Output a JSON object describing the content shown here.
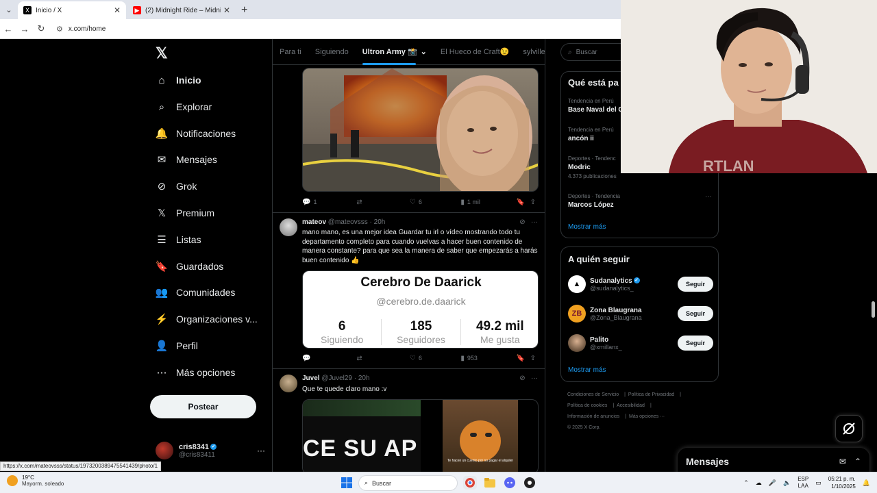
{
  "browser": {
    "tabs": [
      {
        "title": "Inicio / X",
        "active": true
      },
      {
        "title": "(2) Midnight Ride – Midnight R",
        "active": false
      }
    ],
    "url": "x.com/home",
    "status_url": "https://x.com/mateovsss/status/1973200389475541439/photo/1"
  },
  "sidebar": {
    "items": [
      {
        "label": "Inicio",
        "icon": "home-icon"
      },
      {
        "label": "Explorar",
        "icon": "search-icon"
      },
      {
        "label": "Notificaciones",
        "icon": "bell-icon"
      },
      {
        "label": "Mensajes",
        "icon": "mail-icon"
      },
      {
        "label": "Grok",
        "icon": "grok-icon"
      },
      {
        "label": "Premium",
        "icon": "x-icon"
      },
      {
        "label": "Listas",
        "icon": "list-icon"
      },
      {
        "label": "Guardados",
        "icon": "bookmark-icon"
      },
      {
        "label": "Comunidades",
        "icon": "people-icon"
      },
      {
        "label": "Organizaciones v...",
        "icon": "lightning-icon"
      },
      {
        "label": "Perfil",
        "icon": "person-icon"
      },
      {
        "label": "Más opciones",
        "icon": "more-circle-icon"
      }
    ],
    "post_label": "Postear",
    "account": {
      "name": "cris8341",
      "handle": "@cris83411"
    }
  },
  "timeline": {
    "tabs": [
      "Para ti",
      "Siguiendo",
      "Ultron Army 📸",
      "El Hueco de Craft😉",
      "sylville"
    ],
    "first_post_actions": {
      "replies": "1",
      "likes": "6",
      "views": "1 mil"
    },
    "posts": [
      {
        "name": "mateov",
        "meta": "@mateovsss · 20h",
        "text": "mano mano, es una mejor idea Guardar tu irl o vídeo mostrando todo tu departamento completo para cuando vuelvas a hacer buen contenido de manera constante? para que sea la manera de saber que empezarás a harás buen contenido 👍",
        "card": {
          "title": "Cerebro De Daarick",
          "handle": "@cerebro.de.daarick",
          "stats": [
            {
              "value": "6",
              "label": "Siguiendo"
            },
            {
              "value": "185",
              "label": "Seguidores"
            },
            {
              "value": "49.2 mil",
              "label": "Me gusta"
            }
          ]
        },
        "actions": {
          "replies": "",
          "likes": "6",
          "views": "953"
        }
      },
      {
        "name": "Juvel",
        "meta": "@Juvel29 · 20h",
        "text": "Que te quede claro mano :v",
        "media_text": "CE SU AP",
        "caption": "Te hacen un cuento por no pagar el alquiler"
      }
    ]
  },
  "right": {
    "search_placeholder": "Buscar",
    "trends_title": "Qué está pa",
    "trends": [
      {
        "context": "Tendencia en Perú",
        "title": "Base Naval del C",
        "count": ""
      },
      {
        "context": "Tendencia en Perú",
        "title": "ancón ii",
        "count": ""
      },
      {
        "context": "Deportes · Tendenc",
        "title": "Modric",
        "count": "4.373 publicaciones"
      },
      {
        "context": "Deportes · Tendencia",
        "title": "Marcos López",
        "count": ""
      }
    ],
    "show_more": "Mostrar más",
    "who_title": "A quién seguir",
    "who": [
      {
        "name": "Sudanalytics",
        "handle": "@sudanalytics_",
        "button": "Seguir",
        "verified": true
      },
      {
        "name": "Zona Blaugrana",
        "handle": "@Zona_Blaugrana",
        "button": "Seguir",
        "verified": false
      },
      {
        "name": "Palito",
        "handle": "@xmillanx_",
        "button": "Seguir",
        "verified": false
      }
    ],
    "who_more": "Mostrar más",
    "footer": [
      "Condiciones de Servicio",
      "Política de Privacidad",
      "Política de cookies",
      "Accesibilidad",
      "Información de anuncios",
      "Más opciones ···",
      "© 2025 X Corp."
    ],
    "messages_title": "Mensajes"
  },
  "taskbar": {
    "weather_temp": "19°C",
    "weather_desc": "Mayorm. soleado",
    "search_label": "Buscar",
    "lang1": "ESP",
    "lang2": "LAA",
    "time": "05:21 p. m.",
    "date": "1/10/2025"
  },
  "colors": {
    "accent": "#1d9bf0",
    "background": "#000000"
  }
}
